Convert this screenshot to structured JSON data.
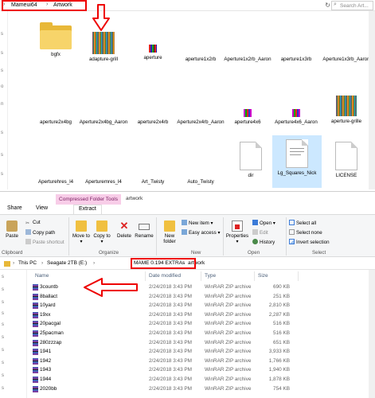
{
  "top": {
    "breadcrumb": [
      "Mameui64",
      "Artwork"
    ],
    "search_placeholder": "Search Art...",
    "files": [
      {
        "label": "bgfx",
        "kind": "folder"
      },
      {
        "label": "adapture-grill",
        "kind": "image"
      },
      {
        "label": "aperture",
        "kind": "image-small"
      },
      {
        "label": "aperture1x2rb",
        "kind": "blank"
      },
      {
        "label": "Aperture1x2rb_Aaron",
        "kind": "blank"
      },
      {
        "label": "aperture1x3rb",
        "kind": "blank"
      },
      {
        "label": "Aperture1x3rb_Aaron",
        "kind": "blank"
      },
      {
        "label": "aperture2x4bg",
        "kind": "blank"
      },
      {
        "label": "Aperture2x4bg_Aaron",
        "kind": "blank"
      },
      {
        "label": "aperture2x4rb",
        "kind": "blank"
      },
      {
        "label": "Aperture2x4rb_Aaron",
        "kind": "blank"
      },
      {
        "label": "aperture4x6",
        "kind": "image-small"
      },
      {
        "label": "Aperture4x6_Aaron",
        "kind": "image-small"
      },
      {
        "label": "aperture-grille",
        "kind": "image"
      },
      {
        "label": "Aperturehres_l4",
        "kind": "blank"
      },
      {
        "label": "Aperturemres_l4",
        "kind": "blank"
      },
      {
        "label": "Art_Twisty",
        "kind": "blank"
      },
      {
        "label": "Auto_Twisty",
        "kind": "blank"
      },
      {
        "label": "dir",
        "kind": "doc"
      },
      {
        "label": "Lg_Squares_Nick",
        "kind": "doc"
      },
      {
        "label": "LICENSE",
        "kind": "doc"
      }
    ],
    "side_labels": [
      "s",
      "s",
      "s",
      "o",
      "n",
      "s",
      "s",
      "s"
    ]
  },
  "bottom": {
    "context_tab": "Compressed Folder Tools",
    "window_title": "artwork",
    "tabs": [
      "Share",
      "View",
      "Extract"
    ],
    "ribbon": {
      "paste": "Paste",
      "cut": "Cut",
      "copy_path": "Copy path",
      "paste_shortcut": "Paste shortcut",
      "clipboard": "Clipboard",
      "move_to": "Move to",
      "copy_to": "Copy to",
      "delete": "Delete",
      "rename": "Rename",
      "organize": "Organize",
      "new_folder": "New folder",
      "new_item": "New item",
      "easy_access": "Easy access",
      "new_group": "New",
      "properties": "Properties",
      "open": "Open",
      "edit": "Edit",
      "history": "History",
      "open_group": "Open",
      "select_all": "Select all",
      "select_none": "Select none",
      "invert_selection": "Invert selection",
      "select_group": "Select"
    },
    "address": [
      "This PC",
      "Seagate 2TB (E:)",
      "MAME 0.194 EXTRAs",
      "artwork"
    ],
    "columns": {
      "name": "Name",
      "date": "Date modified",
      "type": "Type",
      "size": "Size"
    },
    "rows": [
      {
        "name": "3countb",
        "date": "2/24/2018 3:43 PM",
        "type": "WinRAR ZIP archive",
        "size": "690 KB"
      },
      {
        "name": "8ballact",
        "date": "2/24/2018 3:43 PM",
        "type": "WinRAR ZIP archive",
        "size": "251 KB"
      },
      {
        "name": "10yard",
        "date": "2/24/2018 3:43 PM",
        "type": "WinRAR ZIP archive",
        "size": "2,810 KB"
      },
      {
        "name": "19xx",
        "date": "2/24/2018 3:43 PM",
        "type": "WinRAR ZIP archive",
        "size": "2,287 KB"
      },
      {
        "name": "20pacgal",
        "date": "2/24/2018 3:43 PM",
        "type": "WinRAR ZIP archive",
        "size": "516 KB"
      },
      {
        "name": "25pacman",
        "date": "2/24/2018 3:43 PM",
        "type": "WinRAR ZIP archive",
        "size": "516 KB"
      },
      {
        "name": "280zzzap",
        "date": "2/24/2018 3:43 PM",
        "type": "WinRAR ZIP archive",
        "size": "651 KB"
      },
      {
        "name": "1941",
        "date": "2/24/2018 3:43 PM",
        "type": "WinRAR ZIP archive",
        "size": "3,933 KB"
      },
      {
        "name": "1942",
        "date": "2/24/2018 3:43 PM",
        "type": "WinRAR ZIP archive",
        "size": "1,766 KB"
      },
      {
        "name": "1943",
        "date": "2/24/2018 3:43 PM",
        "type": "WinRAR ZIP archive",
        "size": "1,940 KB"
      },
      {
        "name": "1944",
        "date": "2/24/2018 3:43 PM",
        "type": "WinRAR ZIP archive",
        "size": "1,878 KB"
      },
      {
        "name": "2020bb",
        "date": "2/24/2018 3:43 PM",
        "type": "WinRAR ZIP archive",
        "size": "754 KB"
      }
    ],
    "nav_labels": [
      "s",
      "s",
      "s",
      "s",
      "s",
      "s",
      "s",
      "s",
      "s",
      "s"
    ]
  },
  "colors": {
    "highlight": "#e00000",
    "context_tab": "#f8cde8",
    "header_text": "#4c607a",
    "folder": "#e8b838"
  }
}
